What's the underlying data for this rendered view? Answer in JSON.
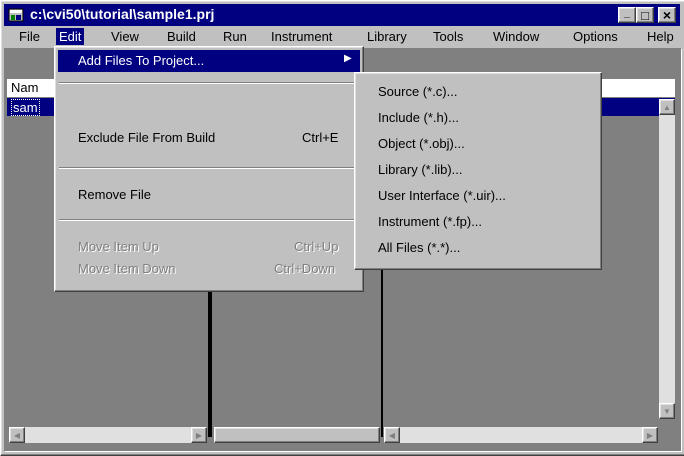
{
  "window": {
    "title": "c:\\cvi50\\tutorial\\sample1.prj",
    "minimize_glyph": "_",
    "maximize_glyph": "□",
    "close_glyph": "×"
  },
  "menubar": [
    "File",
    "Edit",
    "View",
    "Build",
    "Run",
    "Instrument",
    "Library",
    "Tools",
    "Window",
    "Options",
    "Help"
  ],
  "project_list": {
    "header_text": "Nam",
    "row_text": "sam"
  },
  "edit_menu": {
    "add_files": "Add Files To Project...",
    "exclude": "Exclude File From Build",
    "exclude_shortcut": "Ctrl+E",
    "remove": "Remove File",
    "move_up": "Move Item Up",
    "move_up_shortcut": "Ctrl+Up",
    "move_down": "Move Item Down",
    "move_down_shortcut": "Ctrl+Down"
  },
  "add_files_submenu": [
    "Source (*.c)...",
    "Include (*.h)...",
    "Object (*.obj)...",
    "Library (*.lib)...",
    "User Interface (*.uir)...",
    "Instrument (*.fp)...",
    "All Files (*.*)..."
  ]
}
